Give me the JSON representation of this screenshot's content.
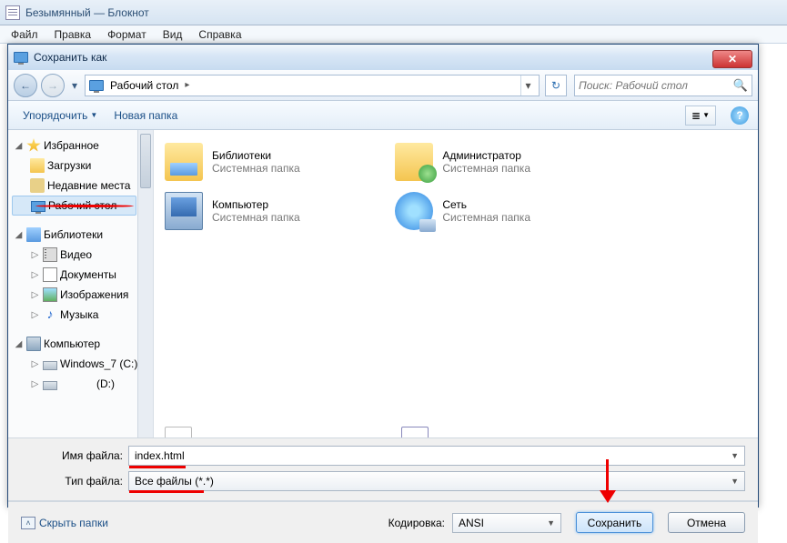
{
  "notepad": {
    "title": "Безымянный — Блокнот",
    "menu": [
      "Файл",
      "Правка",
      "Формат",
      "Вид",
      "Справка"
    ]
  },
  "dialog": {
    "title": "Сохранить как",
    "breadcrumb_location": "Рабочий стол",
    "search_placeholder": "Поиск: Рабочий стол",
    "toolbar": {
      "organize": "Упорядочить",
      "new_folder": "Новая папка"
    },
    "sidebar": {
      "favorites_label": "Избранное",
      "downloads_label": "Загрузки",
      "recent_label": "Недавние места",
      "desktop_label": "Рабочий стол",
      "libraries_label": "Библиотеки",
      "videos_label": "Видео",
      "documents_label": "Документы",
      "images_label": "Изображения",
      "music_label": "Музыка",
      "computer_label": "Компьютер",
      "drive_c_label": "Windows_7 (C:)",
      "drive_d_label": "(D:)"
    },
    "items": {
      "libraries": {
        "name": "Библиотеки",
        "sub": "Системная папка"
      },
      "admin": {
        "name": "Администратор",
        "sub": "Системная папка"
      },
      "computer": {
        "name": "Компьютер",
        "sub": "Системная папка"
      },
      "network": {
        "name": "Сеть",
        "sub": "Системная папка"
      }
    },
    "filename_label": "Имя файла:",
    "filename_value": "index.html",
    "filetype_label": "Тип файла:",
    "filetype_value": "Все файлы  (*.*)",
    "hide_folders": "Скрыть папки",
    "encoding_label": "Кодировка:",
    "encoding_value": "ANSI",
    "save_button": "Сохранить",
    "cancel_button": "Отмена"
  }
}
